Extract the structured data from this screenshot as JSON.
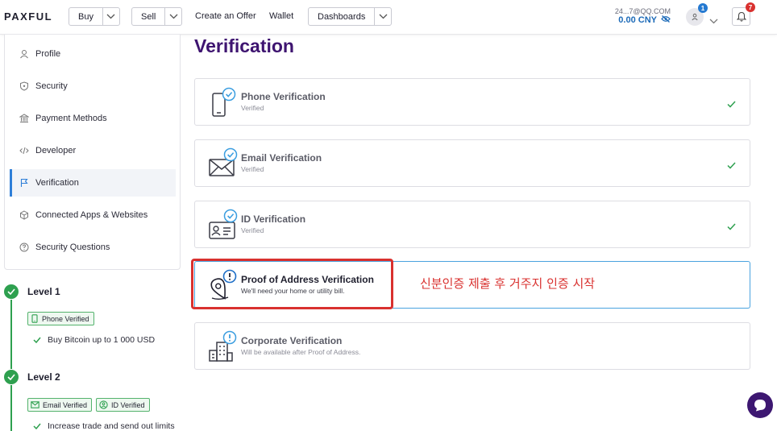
{
  "header": {
    "logo": "PAXFUL",
    "buy_label": "Buy",
    "sell_label": "Sell",
    "create_offer_label": "Create an Offer",
    "wallet_label": "Wallet",
    "dashboards_label": "Dashboards",
    "account_email": "24...7@QQ.COM",
    "balance": "0.00 CNY",
    "profile_badge": "1",
    "notification_badge": "7"
  },
  "sidebar": {
    "items": [
      {
        "label": "Profile",
        "icon": "user-icon"
      },
      {
        "label": "Security",
        "icon": "shield-icon"
      },
      {
        "label": "Payment Methods",
        "icon": "bank-icon"
      },
      {
        "label": "Developer",
        "icon": "code-icon"
      },
      {
        "label": "Verification",
        "icon": "flag-icon",
        "active": true
      },
      {
        "label": "Connected Apps & Websites",
        "icon": "cube-icon"
      },
      {
        "label": "Security Questions",
        "icon": "help-circle-icon"
      }
    ]
  },
  "levels": [
    {
      "title": "Level 1",
      "badges": [
        "Phone Verified"
      ],
      "perk": "Buy Bitcoin up to 1 000 USD"
    },
    {
      "title": "Level 2",
      "badges": [
        "Email Verified",
        "ID Verified"
      ],
      "perk": "Increase trade and send out limits"
    }
  ],
  "main": {
    "title": "Verification",
    "cards": [
      {
        "title": "Phone Verification",
        "subtitle": "Verified",
        "verified": true
      },
      {
        "title": "Email Verification",
        "subtitle": "Verified",
        "verified": true
      },
      {
        "title": "ID Verification",
        "subtitle": "Verified",
        "verified": true
      },
      {
        "title": "Proof of Address Verification",
        "subtitle": "We'll need your home or utility bill.",
        "verified": false
      },
      {
        "title": "Corporate Verification",
        "subtitle": "Will be available after Proof of Address.",
        "verified": false
      }
    ]
  },
  "annotation": "신분인증 제출 후 거주지 인증 시작",
  "colors": {
    "brand_purple": "#3e1470",
    "accent_blue": "#2f7fd8",
    "verified_green": "#2ea04f",
    "annotation_red": "#d9312f"
  }
}
